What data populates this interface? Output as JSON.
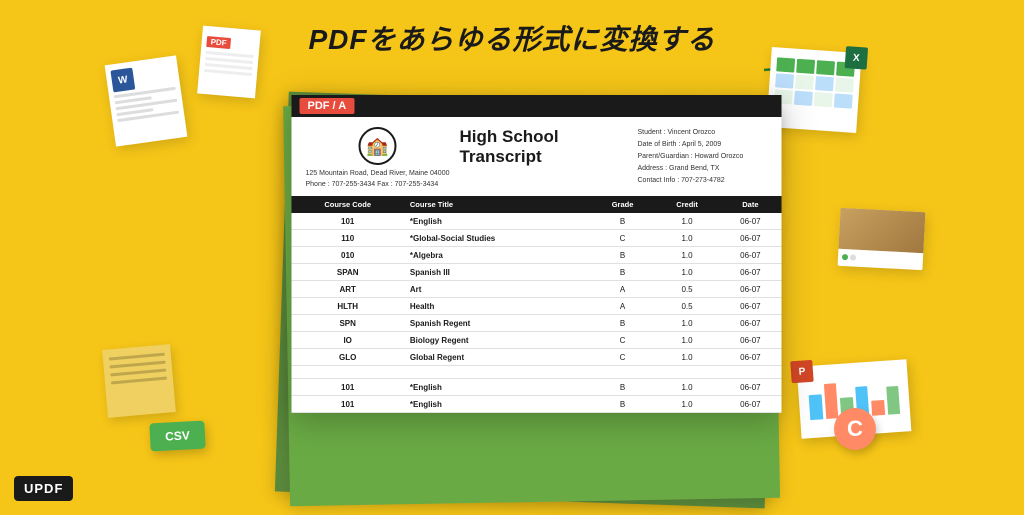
{
  "page": {
    "title": "PDFをあらゆる形式に変換する",
    "background_color": "#F5C518"
  },
  "updf": {
    "logo": "UPDF"
  },
  "pdf_badge": "PDF / A",
  "transcript": {
    "title": "High School Transcript",
    "address": "125 Mountain Road, Dead River, Maine 04000",
    "phone": "Phone : 707-255-3434   Fax : 707-255-3434",
    "student": "Student : Vincent Orozco",
    "dob": "Date of Birth : April 5, 2009",
    "parent": "Parent/Guardian : Howard Orozco",
    "address_info": "Address : Grand Bend, TX",
    "contact": "Contact Info : 707-273-4782",
    "table": {
      "headers": [
        "Course Code",
        "Course Title",
        "Grade",
        "Credit",
        "Date"
      ],
      "rows": [
        [
          "101",
          "*English",
          "B",
          "1.0",
          "06-07"
        ],
        [
          "110",
          "*Global-Social Studies",
          "C",
          "1.0",
          "06-07"
        ],
        [
          "010",
          "*Algebra",
          "B",
          "1.0",
          "06-07"
        ],
        [
          "SPAN",
          "Spanish III",
          "B",
          "1.0",
          "06-07"
        ],
        [
          "ART",
          "Art",
          "A",
          "0.5",
          "06-07"
        ],
        [
          "HLTH",
          "Health",
          "A",
          "0.5",
          "06-07"
        ],
        [
          "SPN",
          "Spanish Regent",
          "B",
          "1.0",
          "06-07"
        ],
        [
          "IO",
          "Biology Regent",
          "C",
          "1.0",
          "06-07"
        ],
        [
          "GLO",
          "Global Regent",
          "C",
          "1.0",
          "06-07"
        ]
      ],
      "rows_bottom": [
        [
          "101",
          "*English",
          "B",
          "1.0",
          "06-07"
        ],
        [
          "101",
          "*English",
          "B",
          "1.0",
          "06-07"
        ]
      ]
    }
  },
  "floats": {
    "word_badge": "W",
    "excel_badge": "X",
    "ppt_badge": "P",
    "csv_label": "CSV",
    "c_badge": "C"
  },
  "arrow": {
    "label": "→"
  }
}
